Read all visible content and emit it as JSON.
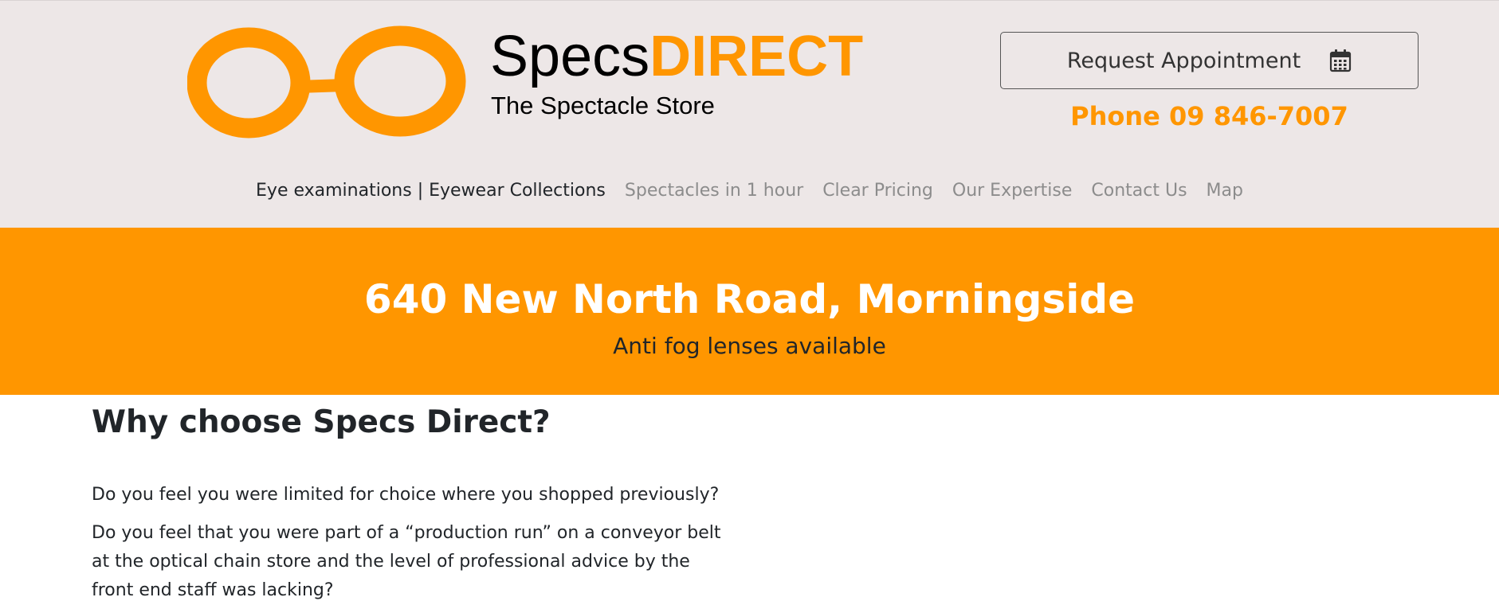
{
  "header": {
    "brand_specs": "Specs",
    "brand_direct": "DIRECT",
    "tagline": "The Spectacle Store",
    "appointment_button": "Request Appointment",
    "phone": "Phone 09 846-7007"
  },
  "icons": {
    "logo": "glasses-logo-icon",
    "appointment": "calendar-icon"
  },
  "colors": {
    "accent": "#ff9600",
    "header_bg": "#ede7e7",
    "text": "#212529",
    "nav_muted": "#8c8c8c"
  },
  "nav": {
    "items": [
      {
        "label": "Eye examinations | Eyewear Collections",
        "active": true
      },
      {
        "label": "Spectacles in 1 hour",
        "active": false
      },
      {
        "label": "Clear Pricing",
        "active": false
      },
      {
        "label": "Our Expertise",
        "active": false
      },
      {
        "label": "Contact Us",
        "active": false
      },
      {
        "label": "Map",
        "active": false
      }
    ]
  },
  "banner": {
    "title": "640 New North Road, Morningside",
    "subtitle": "Anti fog lenses available"
  },
  "content": {
    "heading": "Why choose Specs Direct?",
    "paragraphs": [
      "Do you feel you were limited for choice where you shopped previously?",
      "Do you feel that you were part of a “production run” on a conveyor belt at the optical chain store and the level of professional advice by the front end staff was lacking?"
    ]
  }
}
